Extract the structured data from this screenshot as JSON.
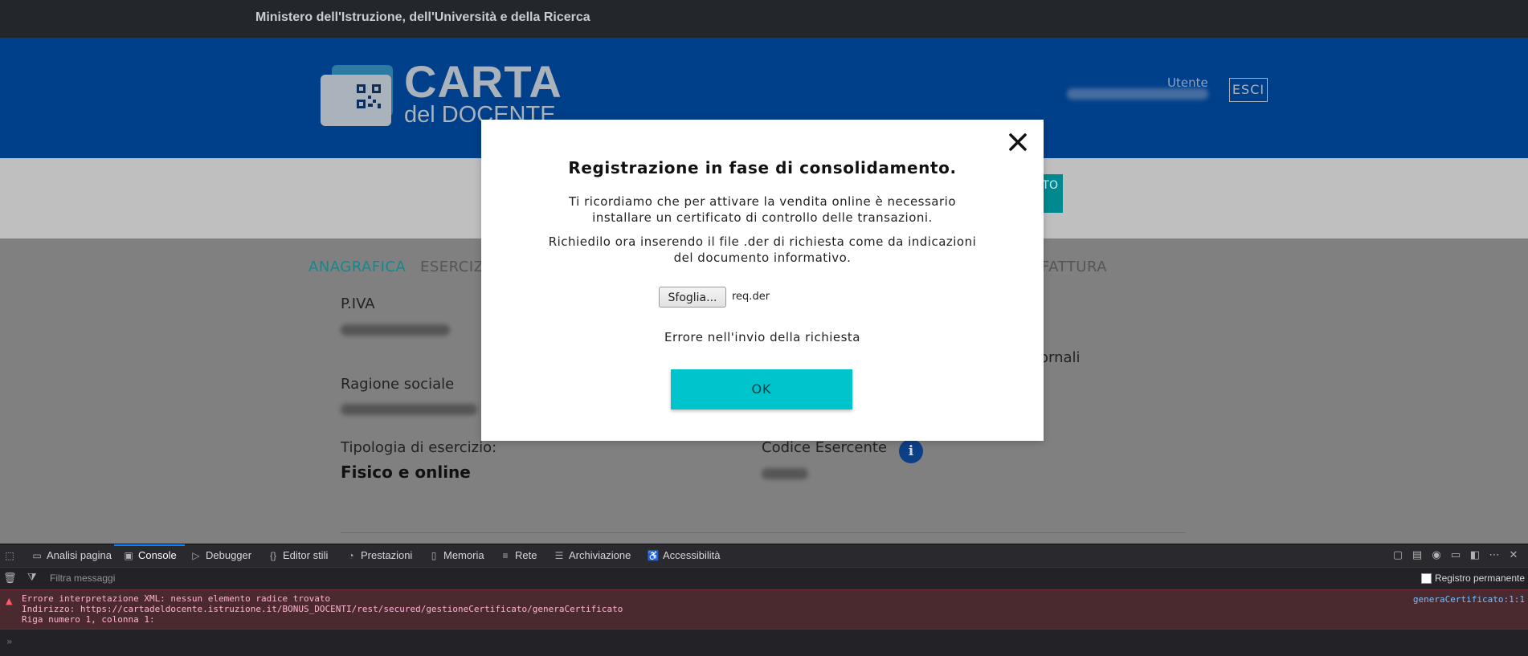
{
  "topbar": {
    "ministry": "Ministero dell'Istruzione, dell'Università e della Ricerca"
  },
  "header": {
    "logo_title": "CARTA",
    "logo_subtitle": "del DOCENTE",
    "user_label": "Utente",
    "logout_label": "ESCI"
  },
  "band": {
    "button_label": "TO"
  },
  "tabs": {
    "anagrafica": "ANAGRAFICA",
    "esercizi": "ESERCIZI",
    "fattura": "FATTURA"
  },
  "form": {
    "piva_label": "P.IVA",
    "ragione_label": "Ragione sociale",
    "tipologia_label": "Tipologia di esercizio:",
    "tipologia_value": "Fisico e online",
    "codice_label": "Codice Esercente",
    "side_text": "ornali",
    "info_glyph": "i"
  },
  "modal": {
    "title": "Registrazione in fase di consolidamento.",
    "para1": "Ti ricordiamo che per attivare la vendita online è necessario installare un certificato di controllo delle transazioni.",
    "para2": "Richiedilo ora inserendo il file .der di richiesta come da indicazioni del documento informativo.",
    "browse_label": "Sfoglia...",
    "file_name": "req.der",
    "error_text": "Errore nell'invio della richiesta",
    "ok_label": "OK"
  },
  "devtools": {
    "tabs": [
      {
        "label": "Analisi pagina",
        "icon": "inspector-icon"
      },
      {
        "label": "Console",
        "icon": "console-icon"
      },
      {
        "label": "Debugger",
        "icon": "debugger-icon"
      },
      {
        "label": "Editor stili",
        "icon": "style-editor-icon"
      },
      {
        "label": "Prestazioni",
        "icon": "performance-icon"
      },
      {
        "label": "Memoria",
        "icon": "memory-icon"
      },
      {
        "label": "Rete",
        "icon": "network-icon"
      },
      {
        "label": "Archiviazione",
        "icon": "storage-icon"
      },
      {
        "label": "Accessibilità",
        "icon": "accessibility-icon"
      }
    ],
    "filter_placeholder": "Filtra messaggi",
    "persist_label": "Registro permanente",
    "error_lines": [
      "Errore interpretazione XML: nessun elemento radice trovato",
      "Indirizzo: https://cartadeldocente.istruzione.it/BONUS_DOCENTI/rest/secured/gestioneCertificato/generaCertificato",
      "Riga numero 1, colonna 1:"
    ],
    "error_source": "generaCertificato:1:1",
    "prompt": "»"
  },
  "colors": {
    "topbar": "#23272b",
    "header_blue": "#003f8a",
    "accent_teal": "#00c4cc",
    "console_error_bg": "#4b2a2f"
  }
}
